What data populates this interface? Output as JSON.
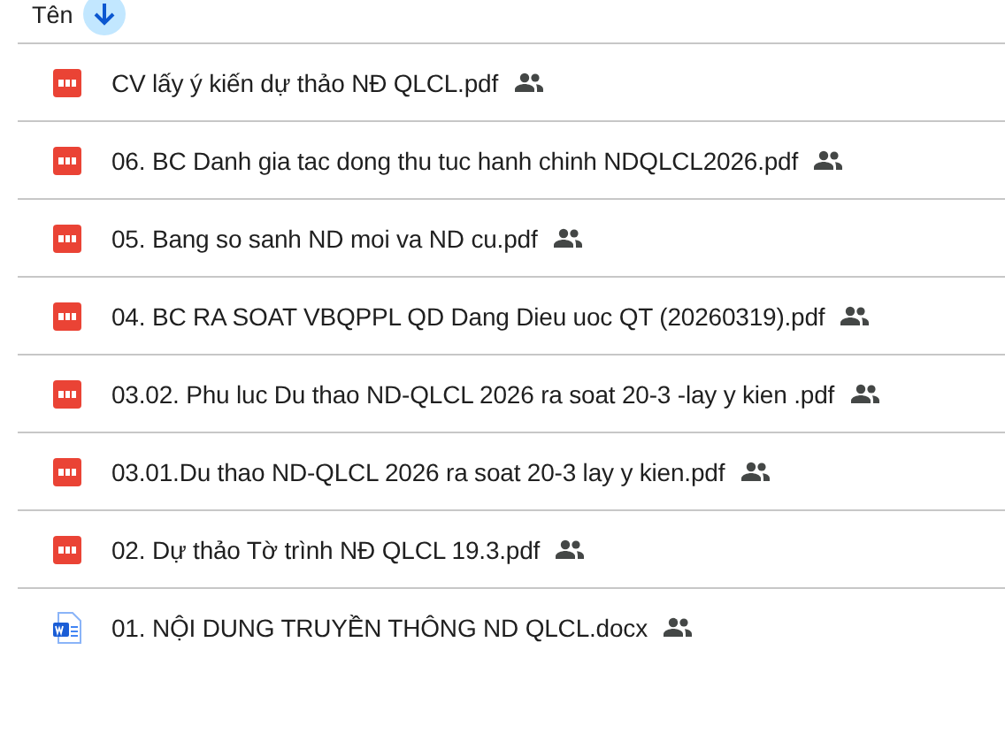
{
  "header": {
    "label": "Tên",
    "sort_descending": true
  },
  "files": [
    {
      "kind": "pdf",
      "name": "CV lấy ý kiến dự thảo NĐ QLCL.pdf",
      "shared": true
    },
    {
      "kind": "pdf",
      "name": "06. BC Danh gia tac dong thu tuc hanh chinh NDQLCL2026.pdf",
      "shared": true
    },
    {
      "kind": "pdf",
      "name": "05. Bang so sanh ND moi va ND cu.pdf",
      "shared": true
    },
    {
      "kind": "pdf",
      "name": "04. BC RA SOAT VBQPPL QD Dang Dieu uoc QT (20260319).pdf",
      "shared": true
    },
    {
      "kind": "pdf",
      "name": "03.02. Phu luc Du thao ND-QLCL 2026 ra soat 20-3 -lay y kien .pdf",
      "shared": true
    },
    {
      "kind": "pdf",
      "name": "03.01.Du thao ND-QLCL 2026 ra soat 20-3 lay y kien.pdf",
      "shared": true
    },
    {
      "kind": "pdf",
      "name": "02. Dự thảo Tờ trình NĐ QLCL 19.3.pdf",
      "shared": true
    },
    {
      "kind": "docx",
      "name": "01. NỘI DUNG TRUYỀN THÔNG ND QLCL.docx",
      "shared": true
    }
  ]
}
